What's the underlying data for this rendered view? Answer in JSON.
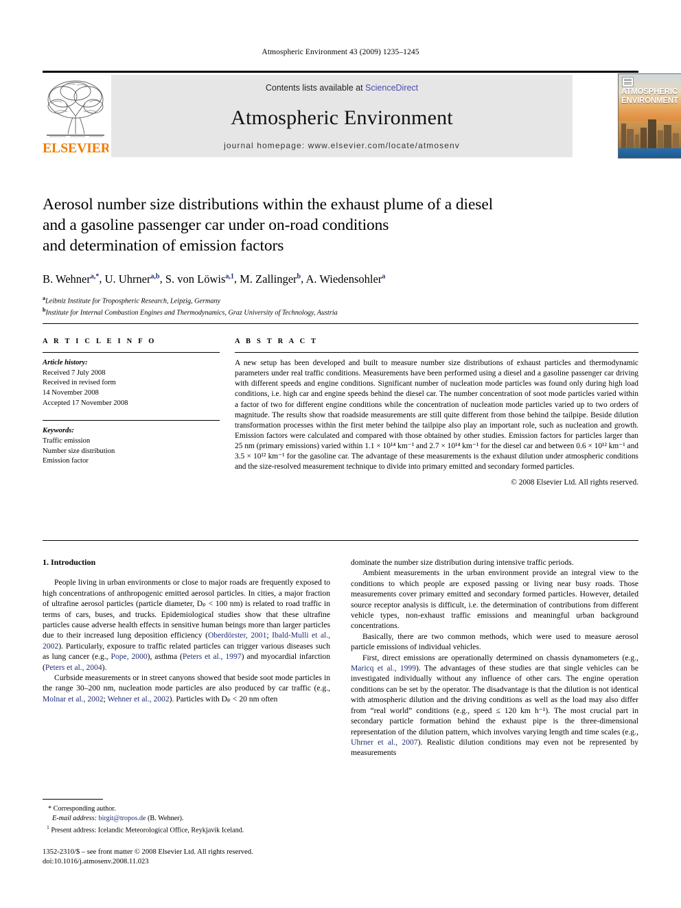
{
  "running_head": "Atmospheric Environment 43 (2009) 1235–1245",
  "masthead": {
    "publisher_name": "ELSEVIER",
    "contents_prefix": "Contents lists available at ",
    "sciencedirect": "ScienceDirect",
    "journal_title": "Atmospheric Environment",
    "homepage": "journal homepage: www.elsevier.com/locate/atmosenv",
    "cover_title_line1": "ATMOSPHERIC",
    "cover_title_line2": "ENVIRONMENT"
  },
  "article": {
    "title_line1": "Aerosol number size distributions within the exhaust plume of a diesel",
    "title_line2": "and a gasoline passenger car under on-road conditions",
    "title_line3": "and determination of emission factors",
    "authors": [
      {
        "name": "B. Wehner",
        "marks": "a,*"
      },
      {
        "name": "U. Uhrner",
        "marks": "a,b"
      },
      {
        "name": "S. von Löwis",
        "marks": "a,1"
      },
      {
        "name": "M. Zallinger",
        "marks": "b"
      },
      {
        "name": "A. Wiedensohler",
        "marks": "a"
      }
    ],
    "affiliations": [
      {
        "mark": "a",
        "text": "Leibniz Institute for Tropospheric Research, Leipzig, Germany"
      },
      {
        "mark": "b",
        "text": "Institute for Internal Combustion Engines and Thermodynamics, Graz University of Technology, Austria"
      }
    ]
  },
  "info": {
    "heading": "A R T I C L E   I N F O",
    "history_label": "Article history:",
    "history": [
      "Received 7 July 2008",
      "Received in revised form",
      "14 November 2008",
      "Accepted 17 November 2008"
    ],
    "keywords_label": "Keywords:",
    "keywords": [
      "Traffic emission",
      "Number size distribution",
      "Emission factor"
    ]
  },
  "abstract": {
    "heading": "A B S T R A C T",
    "text": "A new setup has been developed and built to measure number size distributions of exhaust particles and thermodynamic parameters under real traffic conditions. Measurements have been performed using a diesel and a gasoline passenger car driving with different speeds and engine conditions. Significant number of nucleation mode particles was found only during high load conditions, i.e. high car and engine speeds behind the diesel car. The number concentration of soot mode particles varied within a factor of two for different engine conditions while the concentration of nucleation mode particles varied up to two orders of magnitude. The results show that roadside measurements are still quite different from those behind the tailpipe. Beside dilution transformation processes within the first meter behind the tailpipe also play an important role, such as nucleation and growth. Emission factors were calculated and compared with those obtained by other studies. Emission factors for particles larger than 25 nm (primary emissions) varied within 1.1 × 10¹⁴ km⁻¹ and 2.7 × 10¹⁴ km⁻¹ for the diesel car and between 0.6 × 10¹² km⁻¹ and 3.5 × 10¹² km⁻¹ for the gasoline car. The advantage of these measurements is the exhaust dilution under atmospheric conditions and the size-resolved measurement technique to divide into primary emitted and secondary formed particles.",
    "copyright": "© 2008 Elsevier Ltd. All rights reserved."
  },
  "body": {
    "section_number_title": "1.  Introduction",
    "left_paragraphs": [
      "People living in urban environments or close to major roads are frequently exposed to high concentrations of anthropogenic emitted aerosol particles. In cities, a major fraction of ultrafine aerosol particles (particle diameter, Dₚ < 100 nm) is related to road traffic in terms of cars, buses, and trucks. Epidemiological studies show that these ultrafine particles cause adverse health effects in sensitive human beings more than larger particles due to their increased lung deposition efficiency (Oberdörster, 2001; Ibald-Mulli et al., 2002). Particularly, exposure to traffic related particles can trigger various diseases such as lung cancer (e.g., Pope, 2000), asthma (Peters et al., 1997) and myocardial infarction (Peters et al., 2004).",
      "Curbside measurements or in street canyons showed that beside soot mode particles in the range 30–200 nm, nucleation mode particles are also produced by car traffic (e.g., Molnar et al., 2002; Wehner et al., 2002). Particles with Dₚ < 20 nm often"
    ],
    "right_paragraphs": [
      "dominate the number size distribution during intensive traffic periods.",
      "Ambient measurements in the urban environment provide an integral view to the conditions to which people are exposed passing or living near busy roads. Those measurements cover primary emitted and secondary formed particles. However, detailed source receptor analysis is difficult, i.e. the determination of contributions from different vehicle types, non-exhaust traffic emissions and meaningful urban background concentrations.",
      "Basically, there are two common methods, which were used to measure aerosol particle emissions of individual vehicles.",
      "First, direct emissions are operationally determined on chassis dynamometers (e.g., Maricq et al., 1999). The advantages of these studies are that single vehicles can be investigated individually without any influence of other cars. The engine operation conditions can be set by the operator. The disadvantage is that the dilution is not identical with atmospheric dilution and the driving conditions as well as the load may also differ from “real world” conditions (e.g., speed ≤ 120 km h⁻¹). The most crucial part in secondary particle formation behind the exhaust pipe is the three-dimensional representation of the dilution pattern, which involves varying length and time scales (e.g., Uhrner et al., 2007). Realistic dilution conditions may even not be represented by measurements"
    ]
  },
  "footnotes": {
    "corresponding": "* Corresponding author.",
    "email_label": "E-mail address:",
    "email": "birgit@tropos.de",
    "email_owner": "(B. Wehner).",
    "present_address_mark": "1",
    "present_address": "Present address: Icelandic Meteorological Office, Reykjavik Iceland."
  },
  "imprint": {
    "line1": "1352-2310/$ – see front matter © 2008 Elsevier Ltd. All rights reserved.",
    "line2": "doi:10.1016/j.atmosenv.2008.11.023"
  },
  "colors": {
    "link": "#1c2c73",
    "sciencedirect": "#4a4ab0",
    "elsevier_orange": "#f07d00",
    "band_gray": "#e6e6e6"
  }
}
